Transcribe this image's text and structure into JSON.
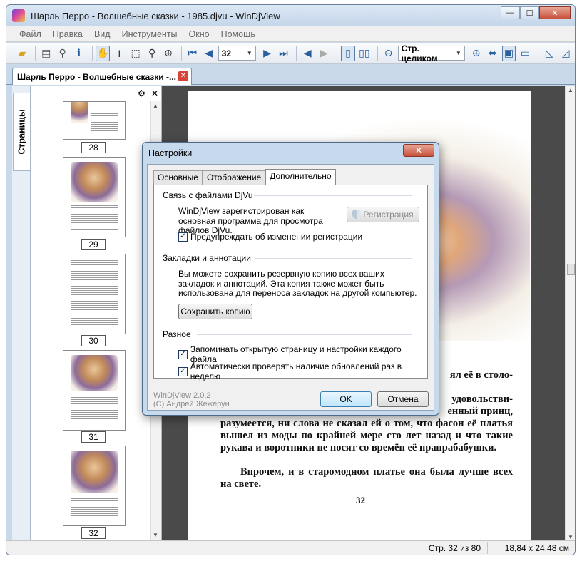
{
  "window": {
    "title": "Шарль Перро - Волшебные сказки - 1985.djvu - WinDjView",
    "controls": {
      "minimize": "—",
      "maximize": "☐",
      "close": "✕"
    }
  },
  "menu": [
    "Файл",
    "Правка",
    "Вид",
    "Инструменты",
    "Окно",
    "Помощь"
  ],
  "toolbar": {
    "page_input": "32",
    "zoom_combo": "Стр. целиком"
  },
  "doc_tab": {
    "label": "Шарль Перро - Волшебные сказки -...",
    "close": "✕"
  },
  "sidebar": {
    "tab_label": "Страницы",
    "settings_icon": "⚙",
    "close_icon": "✕",
    "thumb_labels": [
      "28",
      "29",
      "30",
      "31",
      "32"
    ]
  },
  "page": {
    "text1": "ял её в столо-",
    "text2": "удовольстви-",
    "text3": "енный принц,",
    "text4": "разумеется, ни слова не сказал ей о том, что фасон её платья вышел из моды по крайней мере сто лет назад и что такие рукава и воротники не носят со времён её прапрабабушки.",
    "text5": "Впрочем, и в старомодном платье она была лучше всех на свете.",
    "number": "32"
  },
  "status": {
    "page_info": "Стр. 32 из 80",
    "size_info": "18,84 x 24,48 см"
  },
  "dialog": {
    "title": "Настройки",
    "close": "✕",
    "tabs": [
      "Основные",
      "Отображение",
      "Дополнительно"
    ],
    "active_tab": "Дополнительно",
    "group1_title": "Связь с файлами DjVu",
    "group1_text": "WinDjView зарегистрирован как основная программа для просмотра файлов DjVu.",
    "register_button": "Регистрация",
    "check_warn": "Предупреждать об изменении регистрации",
    "group2_title": "Закладки и аннотации",
    "group2_text": "Вы можете сохранить резервную копию всех ваших закладок и аннотаций. Эта копия также может быть использована для переноса закладок на другой компьютер.",
    "save_button": "Сохранить копию",
    "group3_title": "Разное",
    "check_remember": "Запоминать открытую страницу и настройки каждого файла",
    "check_updates": "Автоматически проверять наличие обновлений раз в неделю",
    "checkmark": "✓",
    "version": "WinDjView 2.0.2",
    "copyright": "(C) Андрей Жежерун",
    "ok": "OK",
    "cancel": "Отмена"
  }
}
